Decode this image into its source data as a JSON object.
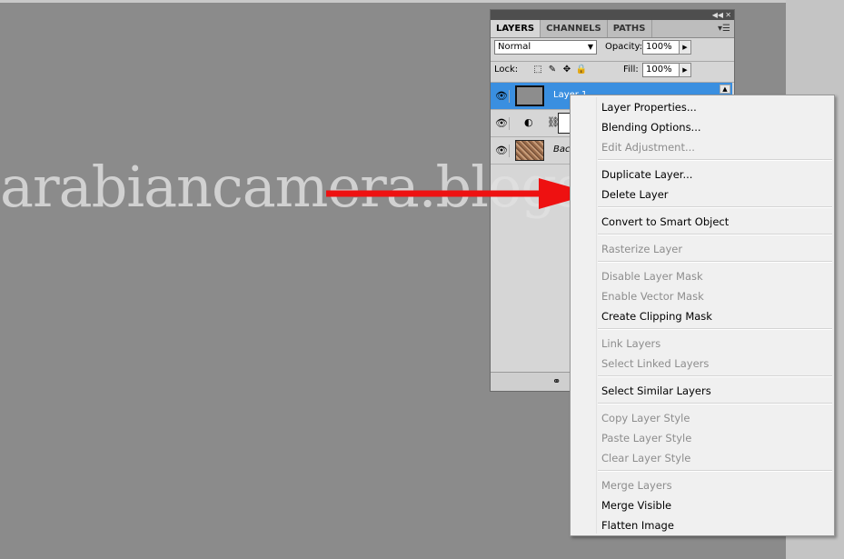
{
  "panel": {
    "tabs": [
      "LAYERS",
      "CHANNELS",
      "PATHS"
    ],
    "blend_mode": "Normal",
    "opacity_label": "Opacity:",
    "opacity_value": "100%",
    "lock_label": "Lock:",
    "fill_label": "Fill:",
    "fill_value": "100%",
    "layers": [
      {
        "name": "Layer 1",
        "selected": true,
        "thumb": "gray"
      },
      {
        "name": "",
        "selected": false,
        "thumb": "adjustment"
      },
      {
        "name": "Background",
        "selected": false,
        "thumb": "photo"
      }
    ]
  },
  "context_menu": {
    "items": [
      {
        "label": "Layer Properties...",
        "enabled": true
      },
      {
        "label": "Blending Options...",
        "enabled": true
      },
      {
        "label": "Edit Adjustment...",
        "enabled": false
      },
      {
        "label": "Duplicate Layer...",
        "enabled": true
      },
      {
        "label": "Delete Layer",
        "enabled": true
      },
      {
        "label": "Convert to Smart Object",
        "enabled": true
      },
      {
        "label": "Rasterize Layer",
        "enabled": false
      },
      {
        "label": "Disable Layer Mask",
        "enabled": false
      },
      {
        "label": "Enable Vector Mask",
        "enabled": false
      },
      {
        "label": "Create Clipping Mask",
        "enabled": true
      },
      {
        "label": "Link Layers",
        "enabled": false
      },
      {
        "label": "Select Linked Layers",
        "enabled": false
      },
      {
        "label": "Select Similar Layers",
        "enabled": true
      },
      {
        "label": "Copy Layer Style",
        "enabled": false
      },
      {
        "label": "Paste Layer Style",
        "enabled": false
      },
      {
        "label": "Clear Layer Style",
        "enabled": false
      },
      {
        "label": "Merge Layers",
        "enabled": false
      },
      {
        "label": "Merge Visible",
        "enabled": true
      },
      {
        "label": "Flatten Image",
        "enabled": true
      }
    ]
  },
  "watermark": "arabiancamera.blogspot.com",
  "colors": {
    "canvas": "#8b8b8b",
    "selection": "#3a8fe0",
    "arrow": "#ee1111"
  }
}
